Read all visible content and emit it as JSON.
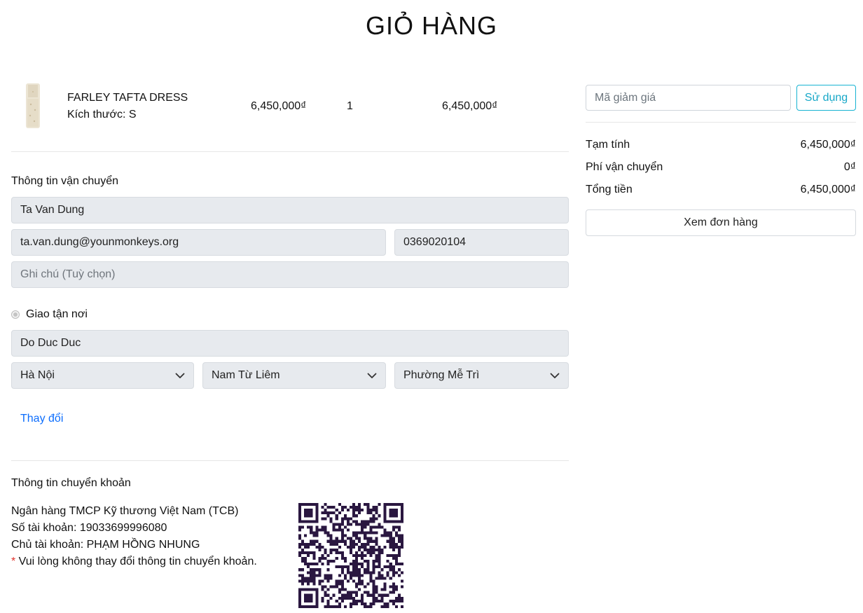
{
  "page": {
    "title": "GIỎ HÀNG"
  },
  "cart": {
    "items": [
      {
        "name": "FARLEY TAFTA DRESS",
        "size_label": "Kích thước: S",
        "price": "6,450,000₫",
        "quantity": "1",
        "total": "6,450,000₫"
      }
    ]
  },
  "shipping": {
    "heading": "Thông tin vận chuyển",
    "name_value": "Ta Van Dung",
    "email_value": "ta.van.dung@younmonkeys.org",
    "phone_value": "0369020104",
    "note_placeholder": "Ghi chú (Tuỳ chọn)",
    "delivery_option_label": "Giao tận nơi",
    "address_value": "Do Duc Duc",
    "city_value": "Hà Nội",
    "district_value": "Nam Từ Liêm",
    "ward_value": "Phường Mễ Trì",
    "change_link": "Thay đổi"
  },
  "bank": {
    "heading": "Thông tin chuyển khoản",
    "bank_name": "Ngân hàng TMCP Kỹ thương Việt Nam (TCB)",
    "account_number": "Số tài khoản: 19033699996080",
    "account_holder": "Chủ tài khoản: PHẠM HỒNG NHUNG",
    "required_marker": "*",
    "warning": " Vui lòng không thay đổi thông tin chuyển khoản."
  },
  "summary": {
    "coupon_placeholder": "Mã giảm giá",
    "coupon_button": "Sử dụng",
    "subtotal_label": "Tạm tính",
    "subtotal_value": "6,450,000₫",
    "shipping_label": "Phí vận chuyển",
    "shipping_value": "0₫",
    "total_label": "Tổng tiền",
    "total_value": "6,450,000₫",
    "view_order_button": "Xem đơn hàng"
  },
  "colors": {
    "link": "#0d6efd",
    "coupon_accent": "#17a8c8",
    "field_bg": "#e7eaee",
    "qr": "#2a1740"
  },
  "icons": [
    "chevron-down-icon",
    "qr-code"
  ]
}
